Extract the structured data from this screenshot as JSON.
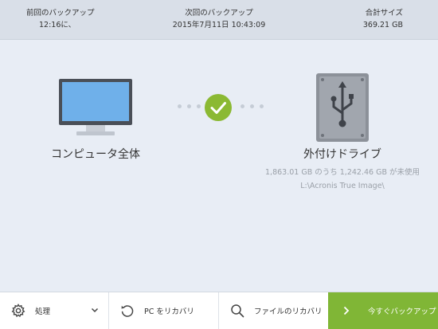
{
  "header": {
    "last_backup_label": "前回のバックアップ",
    "last_backup_value": "12:16に、",
    "next_backup_label": "次回のバックアップ",
    "next_backup_value": "2015年7月11日 10:43:09",
    "total_size_label": "合計サイズ",
    "total_size_value": "369.21 GB"
  },
  "source": {
    "icon": "computer-icon",
    "label": "コンピュータ全体"
  },
  "status": {
    "icon": "checkmark-icon",
    "color": "#8bb933"
  },
  "destination": {
    "icon": "usb-drive-icon",
    "label": "外付けドライブ",
    "usage": "1,863.01 GB のうち 1,242.46 GB が未使用",
    "path": "L:\\Acronis True Image\\"
  },
  "toolbar": {
    "operations_label": "処理",
    "operations_icon": "gear-icon",
    "recover_pc_label": "PC をリカバリ",
    "recover_pc_icon": "refresh-icon",
    "recover_files_label": "ファイルのリカバリ",
    "recover_files_icon": "search-icon",
    "backup_now_label": "今すぐバックアップ",
    "backup_now_icon": "chevron-right-icon",
    "accent": "#80b636"
  }
}
